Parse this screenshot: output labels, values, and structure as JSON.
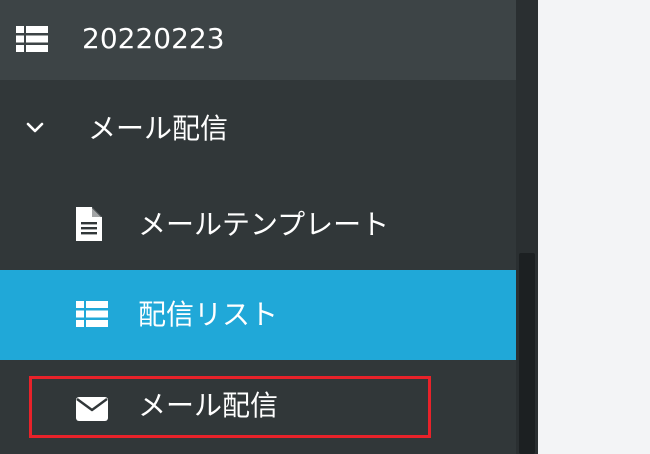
{
  "sidebar": {
    "top_item": {
      "label": "20220223",
      "icon": "list-icon"
    },
    "group": {
      "label": "メール配信",
      "icon": "chevron-down-icon",
      "expanded": true
    },
    "items": [
      {
        "label": "メールテンプレート",
        "icon": "file-text-icon",
        "active": false
      },
      {
        "label": "配信リスト",
        "icon": "list-icon",
        "active": true
      },
      {
        "label": "メール配信",
        "icon": "envelope-icon",
        "active": false
      }
    ]
  },
  "colors": {
    "sidebar_bg": "#313739",
    "top_item_bg": "#3d4446",
    "active_bg": "#20a8d8",
    "highlight_border": "#e8222a",
    "content_bg": "#f3f4f6"
  }
}
